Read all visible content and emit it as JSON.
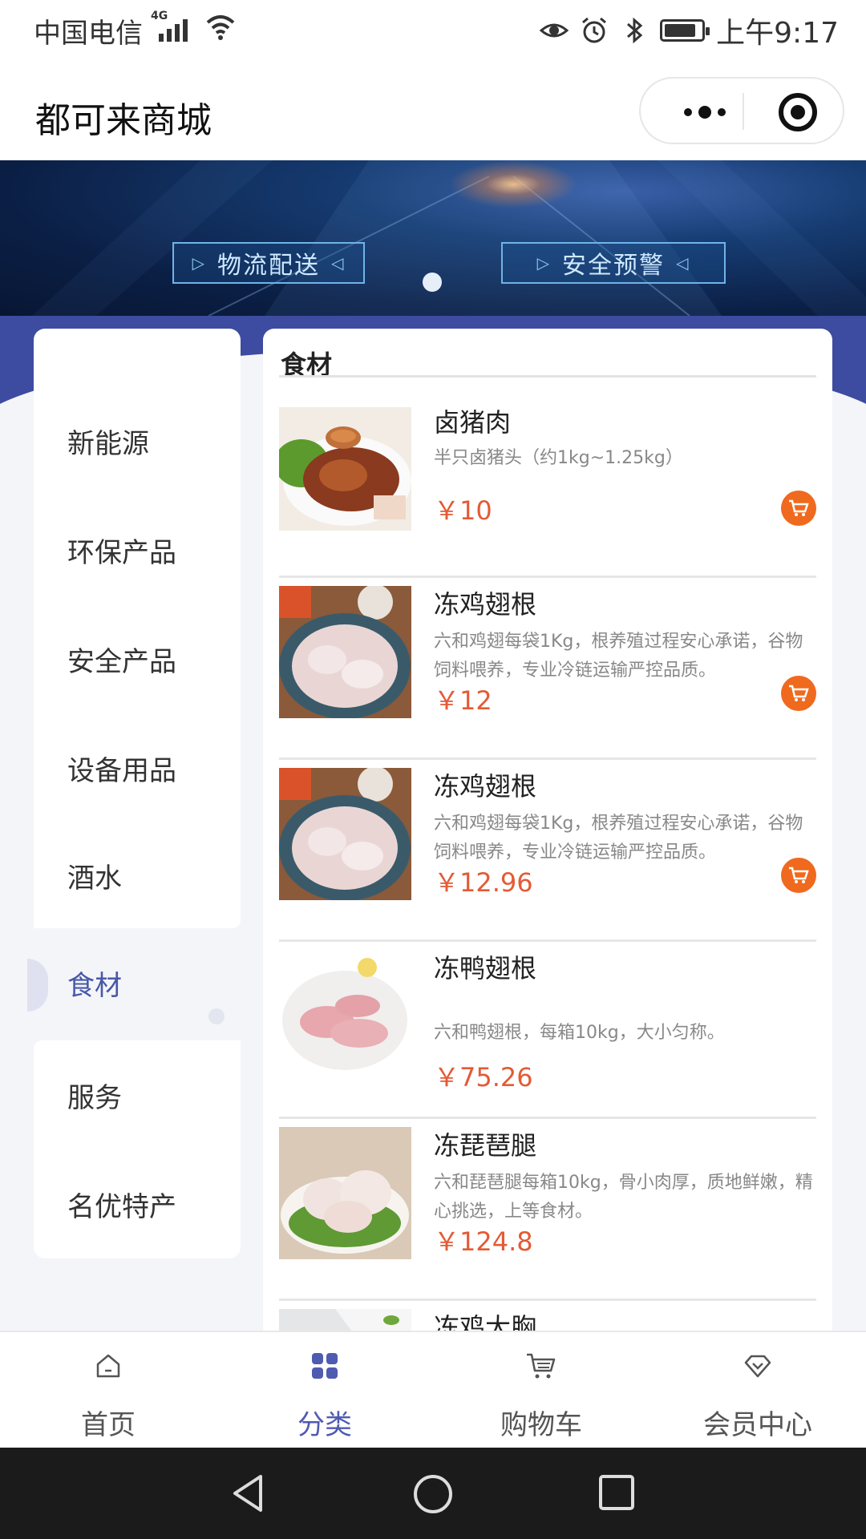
{
  "status_bar": {
    "carrier": "中国电信",
    "network": "4G",
    "time": "上午9:17"
  },
  "nav": {
    "title": "都可来商城"
  },
  "banner": {
    "tags": [
      "物流配送",
      "安全预警"
    ]
  },
  "sidebar": {
    "items": [
      {
        "label": "新能源"
      },
      {
        "label": "环保产品"
      },
      {
        "label": "安全产品"
      },
      {
        "label": "设备用品"
      },
      {
        "label": "酒水"
      },
      {
        "label": "食材",
        "active": true
      },
      {
        "label": "服务"
      },
      {
        "label": "名优特产"
      }
    ]
  },
  "content": {
    "section_title": "食材",
    "products": [
      {
        "name": "卤猪肉",
        "desc": "半只卤猪头（约1kg~1.25kg）",
        "price": "￥10"
      },
      {
        "name": "冻鸡翅根",
        "desc": "六和鸡翅每袋1Kg，根养殖过程安心承诺，谷物饲料喂养，专业冷链运输严控品质。",
        "price": "￥12"
      },
      {
        "name": "冻鸡翅根",
        "desc": "六和鸡翅每袋1Kg，根养殖过程安心承诺，谷物饲料喂养，专业冷链运输严控品质。",
        "price": "￥12.96"
      },
      {
        "name": "冻鸭翅根",
        "desc": "六和鸭翅根，每箱10kg，大小匀称。",
        "price": "￥75.26"
      },
      {
        "name": "冻琵琶腿",
        "desc": "六和琵琶腿每箱10kg，骨小肉厚，质地鲜嫩，精心挑选，上等食材。",
        "price": "￥124.8"
      },
      {
        "name": "冻鸡大胸",
        "desc": "",
        "price": ""
      }
    ]
  },
  "tabbar": {
    "tabs": [
      {
        "label": "首页",
        "icon": "home-icon"
      },
      {
        "label": "分类",
        "icon": "category-icon",
        "active": true
      },
      {
        "label": "购物车",
        "icon": "cart-icon"
      },
      {
        "label": "会员中心",
        "icon": "member-icon"
      }
    ]
  },
  "colors": {
    "accent": "#4f5bb0",
    "price": "#e35b35",
    "cart_button": "#ef6a1e",
    "banner_band": "#3d4ba0"
  }
}
